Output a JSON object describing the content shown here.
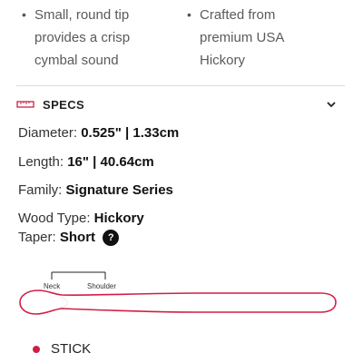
{
  "features": [
    {
      "text": "Small, round tip\nprovides a crisp\ncymbal sound"
    },
    {
      "text": "Crafted from\npremium USA\nHickory"
    }
  ],
  "specs": {
    "title": "SPECS",
    "diameter": {
      "label": "Diameter:",
      "value": "0.525\" | 1.33cm"
    },
    "length": {
      "label": "Length:",
      "value": "16\" | 40.64cm"
    },
    "family": {
      "label": "Family:",
      "value": "Signature Series"
    },
    "wood": {
      "label": "Wood Type:",
      "value": "Hickory"
    },
    "taper": {
      "label": "Taper:",
      "value": "Short"
    },
    "help_glyph": "?"
  },
  "diagram": {
    "neck_label": "Neck",
    "shoulder_label": "Shoulder"
  },
  "legend": {
    "label": "STICK",
    "color": "#d01f43"
  },
  "colors": {
    "accent": "#d01f43"
  },
  "icons": {
    "specs": "ruler-icon",
    "toggle": "chevron-down-icon",
    "help": "question-icon"
  }
}
